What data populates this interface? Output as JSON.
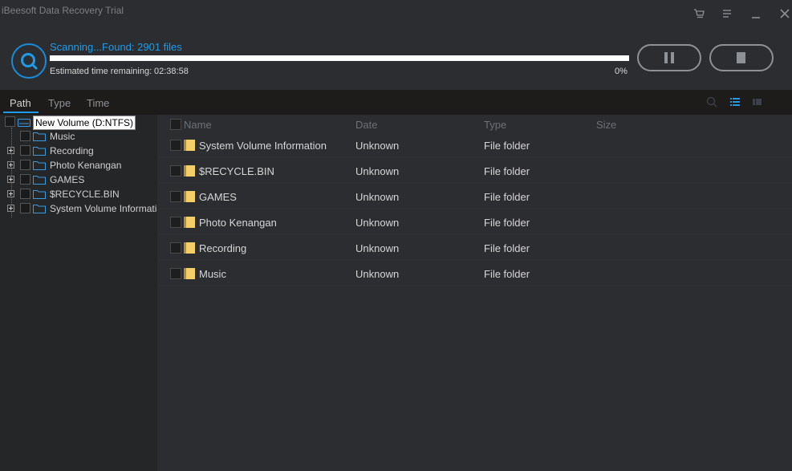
{
  "app": {
    "title": "iBeesoft Data Recovery Trial"
  },
  "window_controls": [
    {
      "name": "cart-icon"
    },
    {
      "name": "menu-icon"
    },
    {
      "name": "minimize-icon"
    },
    {
      "name": "close-icon"
    }
  ],
  "scan": {
    "status": "Scanning...Found: 2901 files",
    "eta_label": "Estimated time remaining:",
    "eta_value": "02:38:58",
    "percent_text": "0%",
    "progress": 0,
    "accent": "#1f9be8"
  },
  "tabs": [
    {
      "label": "Path",
      "active": true
    },
    {
      "label": "Type",
      "active": false
    },
    {
      "label": "Time",
      "active": false
    }
  ],
  "tree": {
    "root": {
      "label": "New Volume (D:NTFS)"
    },
    "children": [
      {
        "label": "Music",
        "expandable": false
      },
      {
        "label": "Recording",
        "expandable": true
      },
      {
        "label": "Photo Kenangan",
        "expandable": true
      },
      {
        "label": "GAMES",
        "expandable": true
      },
      {
        "label": "$RECYCLE.BIN",
        "expandable": true
      },
      {
        "label": "System Volume Informati",
        "expandable": true
      }
    ]
  },
  "list": {
    "columns": {
      "name": "Name",
      "date": "Date",
      "type": "Type",
      "size": "Size"
    },
    "rows": [
      {
        "name": "System Volume Information",
        "date": "Unknown",
        "type": "File folder",
        "size": ""
      },
      {
        "name": "$RECYCLE.BIN",
        "date": "Unknown",
        "type": "File folder",
        "size": ""
      },
      {
        "name": "GAMES",
        "date": "Unknown",
        "type": "File folder",
        "size": ""
      },
      {
        "name": "Photo Kenangan",
        "date": "Unknown",
        "type": "File folder",
        "size": ""
      },
      {
        "name": "Recording",
        "date": "Unknown",
        "type": "File folder",
        "size": ""
      },
      {
        "name": "Music",
        "date": "Unknown",
        "type": "File folder",
        "size": ""
      }
    ]
  }
}
